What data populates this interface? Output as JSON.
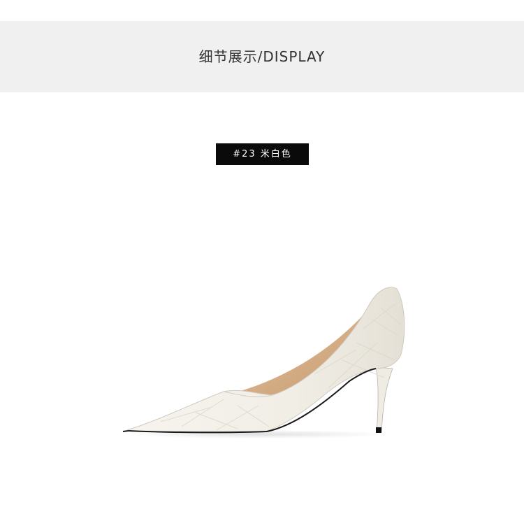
{
  "header": {
    "title": "细节展示/DISPLAY"
  },
  "product": {
    "color_tag": "#23 米白色",
    "image": "pointed-toe-stiletto-pump-photo"
  },
  "colors": {
    "header_band": "#f0f0f0",
    "tag_background": "#0a0a0a",
    "tag_text": "#ffffff",
    "shoe_upper": "#f1eee6",
    "shoe_lining": "#d9b48f"
  }
}
